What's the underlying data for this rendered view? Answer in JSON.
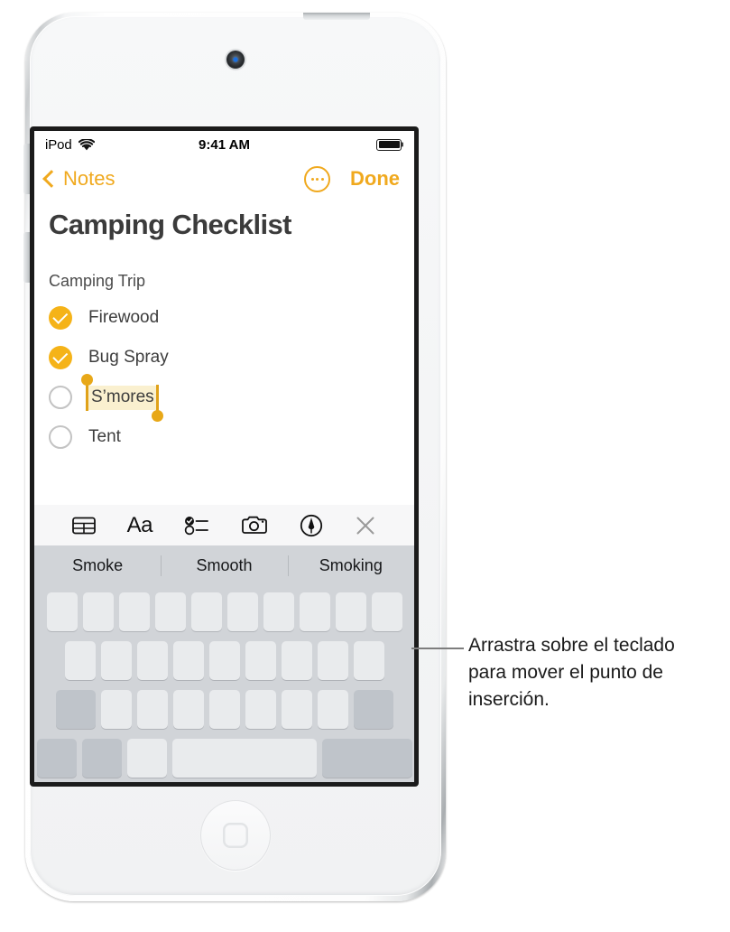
{
  "device": {
    "name": "iPod touch",
    "camera_icon": "front-camera",
    "home_button_icon": "home-button",
    "power_button": "power-button",
    "volume_up_button": "volume-up-button",
    "volume_down_button": "volume-down-button"
  },
  "status_bar": {
    "carrier": "iPod",
    "wifi_icon": "wifi-icon",
    "time": "9:41 AM",
    "battery_icon": "battery-full-icon"
  },
  "nav_bar": {
    "back_label": "Notes",
    "back_chevron_icon": "chevron-left-icon",
    "more_icon": "more-ellipsis-icon",
    "done_label": "Done",
    "accent_color": "#F0A91E"
  },
  "note": {
    "title": "Camping Checklist",
    "subtitle": "Camping Trip",
    "items": [
      {
        "label": "Firewood",
        "checked": true,
        "selected": false
      },
      {
        "label": "Bug Spray",
        "checked": true,
        "selected": false
      },
      {
        "label": "S’mores",
        "checked": false,
        "selected": true
      },
      {
        "label": "Tent",
        "checked": false,
        "selected": false
      }
    ],
    "selection_highlight_color": "#FAF0CF",
    "selection_handle_color": "#E8A818",
    "checkbox_checked_color": "#F5B318"
  },
  "editor_toolbar": {
    "items": [
      {
        "icon": "table-icon",
        "label": ""
      },
      {
        "icon": "text-format-icon",
        "label": "Aa"
      },
      {
        "icon": "checklist-icon",
        "label": ""
      },
      {
        "icon": "camera-icon",
        "label": ""
      },
      {
        "icon": "markup-pen-icon",
        "label": ""
      },
      {
        "icon": "close-x-icon",
        "label": ""
      }
    ]
  },
  "predictive_bar": {
    "suggestions": [
      "Smoke",
      "Smooth",
      "Smoking"
    ]
  },
  "keyboard": {
    "mode": "trackpad-blank",
    "rows": [
      {
        "keys": [
          {
            "type": "letter"
          },
          {
            "type": "letter"
          },
          {
            "type": "letter"
          },
          {
            "type": "letter"
          },
          {
            "type": "letter"
          },
          {
            "type": "letter"
          },
          {
            "type": "letter"
          },
          {
            "type": "letter"
          },
          {
            "type": "letter"
          },
          {
            "type": "letter"
          }
        ]
      },
      {
        "keys": [
          {
            "type": "letter"
          },
          {
            "type": "letter"
          },
          {
            "type": "letter"
          },
          {
            "type": "letter"
          },
          {
            "type": "letter"
          },
          {
            "type": "letter"
          },
          {
            "type": "letter"
          },
          {
            "type": "letter"
          },
          {
            "type": "letter"
          }
        ]
      },
      {
        "keys": [
          {
            "type": "shift"
          },
          {
            "type": "letter"
          },
          {
            "type": "letter"
          },
          {
            "type": "letter"
          },
          {
            "type": "letter"
          },
          {
            "type": "letter"
          },
          {
            "type": "letter"
          },
          {
            "type": "letter"
          },
          {
            "type": "delete"
          }
        ]
      },
      {
        "keys": [
          {
            "type": "numbers"
          },
          {
            "type": "globe"
          },
          {
            "type": "mic"
          },
          {
            "type": "space"
          },
          {
            "type": "return"
          }
        ]
      }
    ]
  },
  "callout": {
    "text": "Arrastra sobre el teclado para mover el punto de inserción.",
    "leader_line": "callout-leader-line"
  }
}
